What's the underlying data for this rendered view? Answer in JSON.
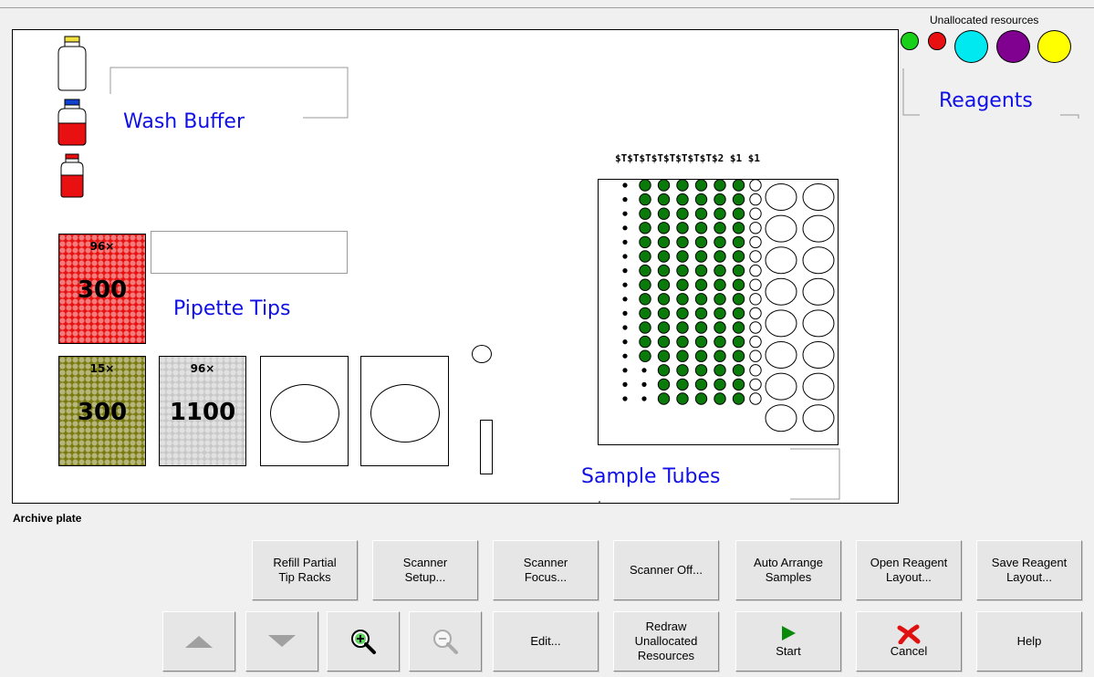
{
  "unallocated": {
    "title": "Unallocated resources",
    "colors": [
      "#18d018",
      "#e81010",
      "#00e8f0",
      "#800090",
      "#ffff00"
    ]
  },
  "deck": {
    "wash_buffer_label": "Wash Buffer",
    "pipette_tips_label": "Pipette Tips",
    "sample_tubes_label": "Sample Tubes",
    "reagents_label": "Reagents",
    "tip_racks": [
      {
        "count": "96×",
        "volume": "300",
        "color": "#e81010"
      },
      {
        "count": "15×",
        "volume": "300",
        "color": "#7a7a10"
      },
      {
        "count": "96×",
        "volume": "1100",
        "color": "#c8c8c8"
      }
    ],
    "tube_headers": "$T$T$T$T$T$T$T$T$2  $1   $1",
    "bottle_colors": {
      "cap1": "#f0e040",
      "cap2": "#1040d0",
      "cap3": "#e81010",
      "liquid": "#e81010"
    },
    "tube_color": "#0a7a0a"
  },
  "status_text": "Archive plate",
  "buttons": {
    "refill": "Refill Partial\nTip Racks",
    "scanner_setup": "Scanner\nSetup...",
    "scanner_focus": "Scanner\nFocus...",
    "scanner_off": "Scanner Off...",
    "auto_arrange": "Auto Arrange\nSamples",
    "open_layout": "Open Reagent\nLayout...",
    "save_layout": "Save Reagent\nLayout...",
    "edit": "Edit...",
    "redraw": "Redraw\nUnallocated\nResources",
    "start": "Start",
    "cancel": "Cancel",
    "help": "Help"
  }
}
